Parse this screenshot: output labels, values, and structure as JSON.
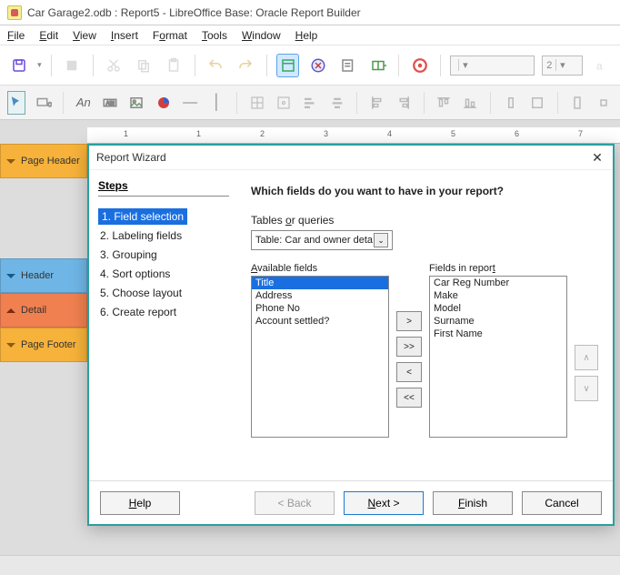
{
  "window": {
    "title": "Car Garage2.odb : Report5 - LibreOffice Base: Oracle Report Builder"
  },
  "menu": {
    "file": "File",
    "edit": "Edit",
    "view": "View",
    "insert": "Insert",
    "format": "Format",
    "tools": "Tools",
    "window": "Window",
    "help": "Help"
  },
  "toolbar": {
    "font_size": "2",
    "font_name": ""
  },
  "bands": {
    "page_header": "Page Header",
    "header": "Header",
    "detail": "Detail",
    "page_footer": "Page Footer"
  },
  "ruler": {
    "ticks": [
      "1",
      "1",
      "2",
      "3",
      "4",
      "5",
      "6",
      "7"
    ]
  },
  "dialog": {
    "title": "Report Wizard",
    "steps_label": "Steps",
    "steps": [
      "1. Field selection",
      "2. Labeling fields",
      "3. Grouping",
      "4. Sort options",
      "5. Choose layout",
      "6. Create report"
    ],
    "current_step": 0,
    "question": "Which fields do you want to have in your report?",
    "tables_label": "Tables or queries",
    "table_selected": "Table: Car and owner deta",
    "available_label": "Available fields",
    "available": [
      "Title",
      "Address",
      "Phone No",
      "Account settled?"
    ],
    "available_selected": 0,
    "in_report_label": "Fields in report",
    "in_report": [
      "Car Reg Number",
      "Make",
      "Model",
      "Surname",
      "First Name"
    ],
    "move": {
      "add": ">",
      "add_all": ">>",
      "remove": "<",
      "remove_all": "<<",
      "up": "∧",
      "down": "∨"
    },
    "buttons": {
      "help": "Help",
      "back": "< Back",
      "next": "Next >",
      "finish": "Finish",
      "cancel": "Cancel"
    }
  }
}
